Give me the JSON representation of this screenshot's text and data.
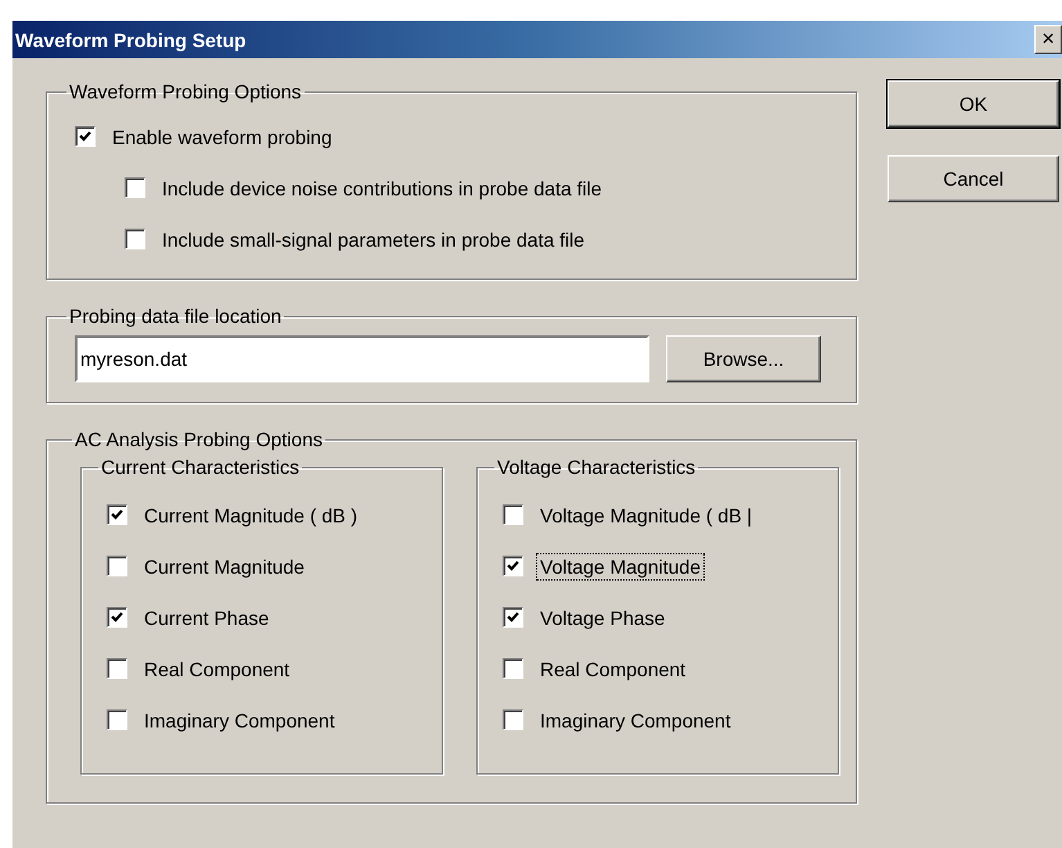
{
  "window": {
    "title": "Waveform Probing Setup",
    "close": "×"
  },
  "waveform_options": {
    "legend": "Waveform Probing Options",
    "items": [
      {
        "label": "Enable waveform probing",
        "checked": true,
        "children": [
          {
            "label": "Include device noise contributions in probe data file",
            "checked": false
          },
          {
            "label": "Include small-signal parameters in probe data file",
            "checked": false
          }
        ]
      }
    ]
  },
  "file_location": {
    "legend": "Probing data file location",
    "value": "myreson.dat",
    "browse": "Browse..."
  },
  "ac_options": {
    "legend": "AC Analysis Probing Options",
    "groups": [
      {
        "legend": "Current Characteristics",
        "items": [
          {
            "label": "Current Magnitude ( dB )",
            "checked": true,
            "focused": false
          },
          {
            "label": "Current Magnitude",
            "checked": false,
            "focused": false
          },
          {
            "label": "Current Phase",
            "checked": true,
            "focused": false
          },
          {
            "label": "Real Component",
            "checked": false,
            "focused": false
          },
          {
            "label": "Imaginary Component",
            "checked": false,
            "focused": false
          }
        ]
      },
      {
        "legend": "Voltage Characteristics",
        "items": [
          {
            "label": "Voltage Magnitude ( dB |",
            "checked": false,
            "focused": false
          },
          {
            "label": "Voltage Magnitude",
            "checked": true,
            "focused": true
          },
          {
            "label": "Voltage Phase",
            "checked": true,
            "focused": false
          },
          {
            "label": "Real Component",
            "checked": false,
            "focused": false
          },
          {
            "label": "Imaginary Component",
            "checked": false,
            "focused": false
          }
        ]
      }
    ]
  },
  "buttons": [
    "OK",
    "Cancel"
  ]
}
